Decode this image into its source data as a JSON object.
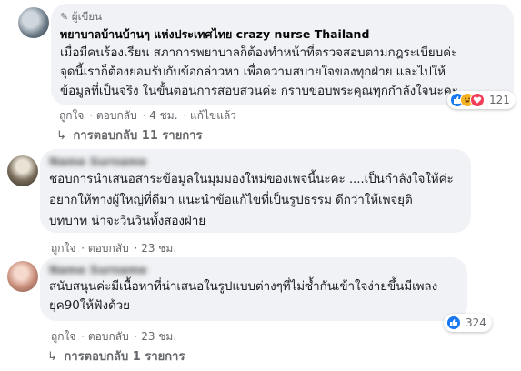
{
  "comments": [
    {
      "author_badge": "ผู้เขียน",
      "author": "พยาบาลบ้านบ้านๆ แห่งประเทศไทย crazy nurse Thailand",
      "text": "เมื่อมีคนร้องเรียน สภาการพยาบาลก็ต้องทำหน้าที่ตรวจสอบตามกฎระเบียบค่ะ\nจุดนี้เราก็ต้องยอมรับกับข้อกล่าวหา เพื่อความสบายใจของทุกฝ่าย และไปให้\nข้อมูลที่เป็นจริง ในขั้นตอนการสอบสวนค่ะ กราบขอบพระคุณทุกกำลังใจนะคะ",
      "actions": {
        "like": "ถูกใจ",
        "reply": "ตอบกลับ",
        "time": "4 ชม.",
        "edited": "แก้ไขแล้ว"
      },
      "reaction_count": "121",
      "replies_label": "การตอบกลับ 11 รายการ"
    },
    {
      "author": "Name Surname",
      "text": "ชอบการนำเสนอสาระข้อมูลในมุมมองใหม่ของเพจนี้นะคะ ....เป็นกำลังใจให้ค่ะ\nอยากให้ทางผู้ใหญ่ที่ดีมา แนะนำข้อแก้ไขที่เป็นรูปธรรม ดีกว่าให้เพจยุติ\nบทบาท น่าจะวินวินทั้งสองฝ่าย",
      "actions": {
        "like": "ถูกใจ",
        "reply": "ตอบกลับ",
        "time": "23 ชม."
      }
    },
    {
      "author": "Name Surname",
      "text": "สนับสนุนค่ะมีเนื้อหาที่น่าเสนอในรูปแบบต่างๆที่ไม่ซ้ำกันเข้าใจง่ายขึ้นมีเพลง\nยุค90ให้ฟังด้วย",
      "actions": {
        "like": "ถูกใจ",
        "reply": "ตอบกลับ",
        "time": "23 ชม."
      },
      "reaction_count": "324",
      "replies_label": "การตอบกลับ 1 รายการ"
    }
  ],
  "colors": {
    "bubble": "#f0f2f5",
    "meta": "#65676b",
    "like": "#1877f2"
  },
  "icons": [
    "admin-badge-icon",
    "like-reaction-icon",
    "haha-reaction-icon",
    "love-reaction-icon",
    "reply-arrow-icon"
  ]
}
